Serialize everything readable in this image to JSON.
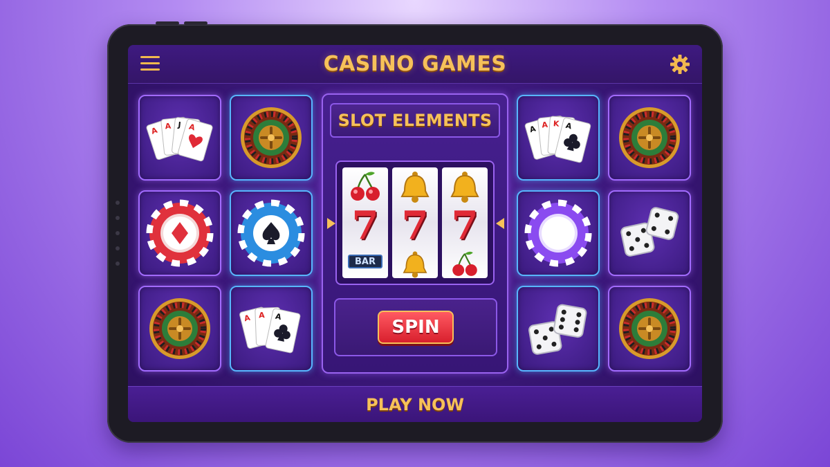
{
  "header": {
    "title": "CASINO GAMES",
    "menu_icon": "hamburger-menu-icon",
    "settings_icon": "gear-icon"
  },
  "center": {
    "label": "SLOT ELEMENTS",
    "reels": [
      [
        "cherry",
        "seven",
        "bar"
      ],
      [
        "bell",
        "seven",
        "bell"
      ],
      [
        "bell",
        "seven",
        "cherry"
      ]
    ],
    "bar_text": "BAR",
    "seven_text": "7",
    "spin_label": "SPIN"
  },
  "left_tiles": [
    "playing-cards-hearts",
    "roulette-wheel",
    "poker-chip-diamond",
    "poker-chip-spade",
    "roulette-wheel",
    "playing-cards-clubs"
  ],
  "right_tiles": [
    "playing-cards-clubs",
    "roulette-wheel",
    "poker-chip-purple",
    "dice",
    "dice",
    "roulette-wheel"
  ],
  "footer": {
    "label": "PLAY NOW"
  },
  "colors": {
    "accent_gold": "#f6c15a",
    "tile_border_purple": "#a26bff",
    "tile_border_blue": "#58b6ff",
    "spin_red": "#e02a36"
  }
}
